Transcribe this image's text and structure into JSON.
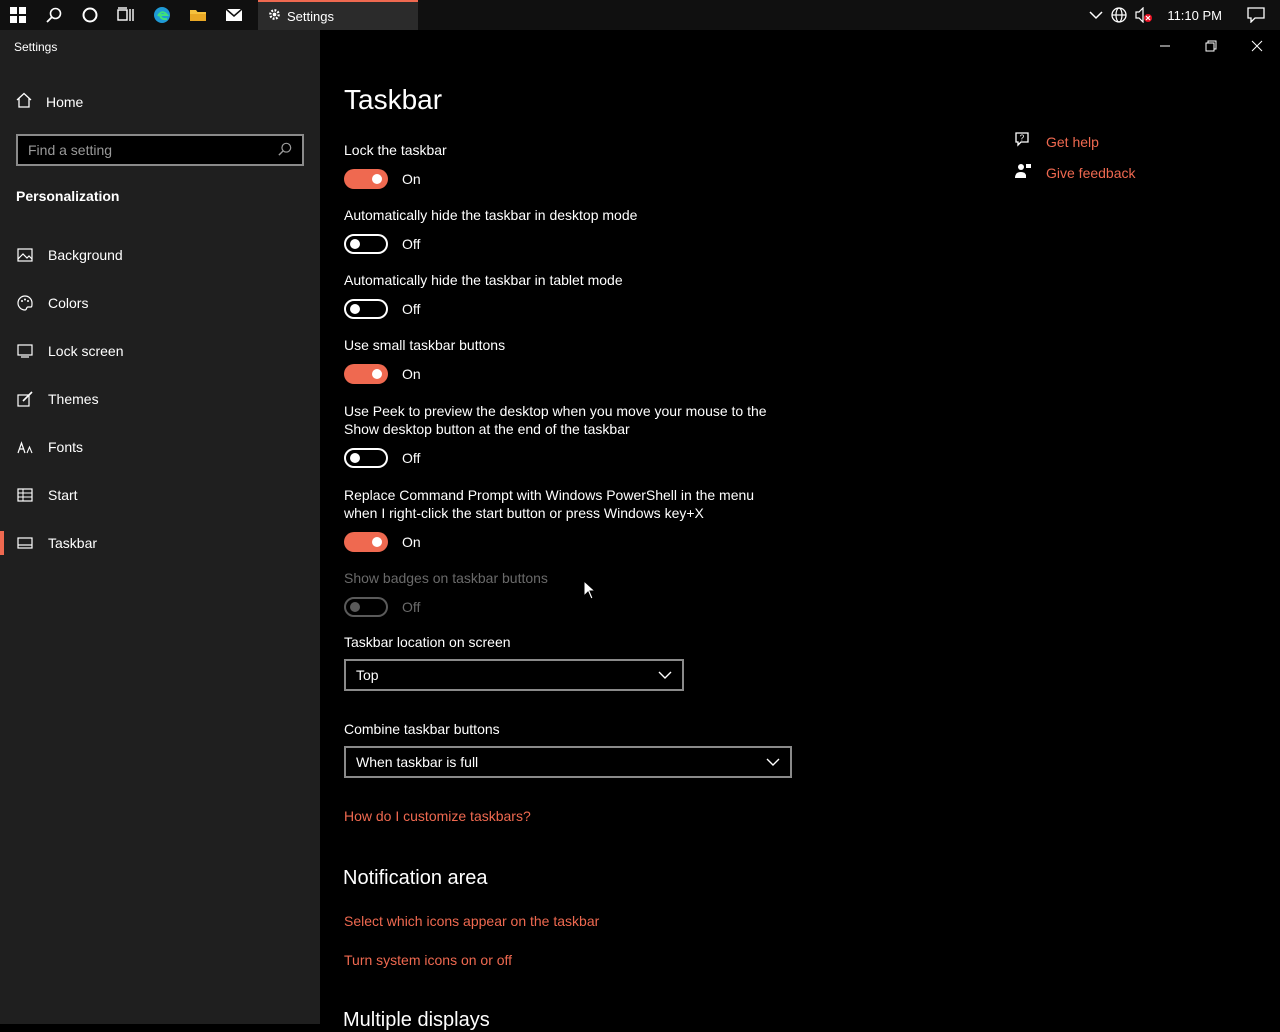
{
  "taskbar": {
    "icons": [
      "windows-start-icon",
      "search-icon",
      "cortana-icon",
      "task-view-icon",
      "edge-icon",
      "file-explorer-icon",
      "mail-icon"
    ],
    "active_app": {
      "label": "Settings",
      "icon": "gear-icon"
    },
    "tray": {
      "clock": "11:10 PM",
      "icons": [
        "chevron-up-icon",
        "network-globe-icon",
        "volume-muted-icon",
        "notification-icon"
      ]
    },
    "accent": "#ef6950"
  },
  "window": {
    "title": "Settings"
  },
  "sidebar": {
    "home_label": "Home",
    "search_placeholder": "Find a setting",
    "section": "Personalization",
    "items": [
      {
        "label": "Background",
        "icon": "picture-icon"
      },
      {
        "label": "Colors",
        "icon": "palette-icon"
      },
      {
        "label": "Lock screen",
        "icon": "monitor-icon"
      },
      {
        "label": "Themes",
        "icon": "brush-icon"
      },
      {
        "label": "Fonts",
        "icon": "fonts-icon"
      },
      {
        "label": "Start",
        "icon": "start-icon"
      },
      {
        "label": "Taskbar",
        "icon": "taskbar-icon",
        "active": true
      }
    ]
  },
  "main": {
    "title": "Taskbar",
    "settings": [
      {
        "label": "Lock the taskbar",
        "state": "On"
      },
      {
        "label": "Automatically hide the taskbar in desktop mode",
        "state": "Off"
      },
      {
        "label": "Automatically hide the taskbar in tablet mode",
        "state": "Off"
      },
      {
        "label": "Use small taskbar buttons",
        "state": "On"
      },
      {
        "label": "Use Peek to preview the desktop when you move your mouse to the Show desktop button at the end of the taskbar",
        "state": "Off"
      },
      {
        "label": "Replace Command Prompt with Windows PowerShell in the menu when I right-click the start button or press Windows key+X",
        "state": "On"
      },
      {
        "label": "Show badges on taskbar buttons",
        "state": "Off",
        "disabled": true
      }
    ],
    "location": {
      "label": "Taskbar location on screen",
      "value": "Top"
    },
    "combine": {
      "label": "Combine taskbar buttons",
      "value": "When taskbar is full"
    },
    "customize_link": "How do I customize taskbars?",
    "notification_area": {
      "heading": "Notification area",
      "links": [
        "Select which icons appear on the taskbar",
        "Turn system icons on or off"
      ]
    },
    "multiple_displays_heading": "Multiple displays"
  },
  "help": {
    "get_help": "Get help",
    "give_feedback": "Give feedback"
  }
}
